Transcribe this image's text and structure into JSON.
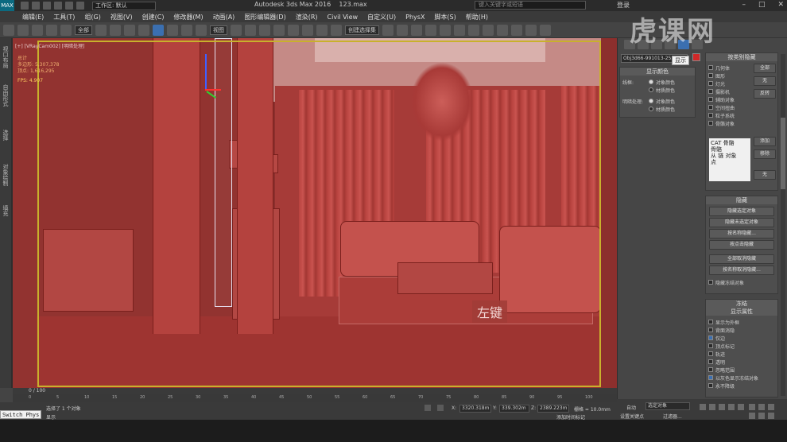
{
  "app": {
    "window_title": "Autodesk 3ds Max 2016",
    "file_name": "123.max",
    "workspace_label": "工作区: 默认",
    "search_placeholder": "键入关键字或短语",
    "login": "登录",
    "logo_text": "MAX"
  },
  "menu": [
    "编辑(E)",
    "工具(T)",
    "组(G)",
    "视图(V)",
    "创建(C)",
    "修改器(M)",
    "动画(A)",
    "图形编辑器(D)",
    "渲染(R)",
    "Civil View",
    "自定义(U)",
    "PhysX",
    "脚本(S)",
    "帮助(H)"
  ],
  "toolbar": {
    "filter_select": "全部",
    "view_select": "视图",
    "named_selection": "创建选择集"
  },
  "left_column": [
    "视口布局",
    "自由形式",
    "选择",
    "对象绘制",
    "填充"
  ],
  "viewport": {
    "label": "[+] [VRayCam002] [明暗处理]",
    "stats": {
      "total_label": "总计",
      "polys_label": "多边形:",
      "polys": "5,307,378",
      "verts_label": "顶点:",
      "verts": "1,616,295",
      "fps_label": "FPS:",
      "fps": "4.907"
    },
    "overlay_text": "左键"
  },
  "panel": {
    "object_name": "Obj3d66-991013-253-810",
    "tooltip": "显示",
    "object_color": "#d02828",
    "display_color": {
      "title": "显示颜色",
      "wireframe_label": "线框:",
      "shaded_label": "明暗处理:",
      "options": [
        "对象颜色",
        "材质颜色"
      ]
    },
    "hide_by_category": {
      "title": "按类别隐藏",
      "items": [
        "几何体",
        "图形",
        "灯光",
        "摄影机",
        "辅助对象",
        "空间扭曲",
        "粒子系统",
        "骨骼对象"
      ],
      "buttons": [
        "全部",
        "无",
        "反转"
      ],
      "list_items": [
        "CAT 骨骼",
        "骨骼",
        "从 链 对象",
        "点"
      ],
      "list_buttons": [
        "添加",
        "移除",
        "无"
      ]
    },
    "hide": {
      "title": "隐藏",
      "buttons": [
        "隐藏选定对象",
        "隐藏未选定对象",
        "按名称隐藏...",
        "按点击隐藏",
        "全部取消隐藏",
        "按名称取消隐藏..."
      ],
      "checkbox": "隐藏冻结对象"
    },
    "freeze": {
      "title": "冻结",
      "sub_title": "显示属性",
      "checkboxes": [
        {
          "label": "显示为外框",
          "checked": false
        },
        {
          "label": "背面消隐",
          "checked": false
        },
        {
          "label": "仅边",
          "checked": true
        },
        {
          "label": "顶点标记",
          "checked": false
        },
        {
          "label": "轨迹",
          "checked": false
        },
        {
          "label": "透明",
          "checked": false
        },
        {
          "label": "忽略范围",
          "checked": false
        },
        {
          "label": "以灰色显示冻结对象",
          "checked": true
        },
        {
          "label": "永不降级",
          "checked": false
        }
      ]
    }
  },
  "timeline": {
    "frame_label": "0 / 100",
    "ticks": [
      "0",
      "5",
      "10",
      "15",
      "20",
      "25",
      "30",
      "35",
      "40",
      "45",
      "50",
      "55",
      "60",
      "65",
      "70",
      "75",
      "80",
      "85",
      "90",
      "95",
      "100"
    ]
  },
  "status": {
    "script_label": "Switch Phys",
    "selection_text": "选择了 1 个对象",
    "prompt_text": "显示",
    "x_label": "X:",
    "x": "3320.318m",
    "y_label": "Y:",
    "y": "339.302m",
    "z_label": "Z:",
    "z": "2389.223m",
    "grid": "栅格 = 10.0mm",
    "add_time_tag": "添加时间标记",
    "auto_key": "自动",
    "set_key": "设置关键点",
    "key_select": "选定对象",
    "key_filter": "过滤器..."
  },
  "watermark": "虎课网"
}
